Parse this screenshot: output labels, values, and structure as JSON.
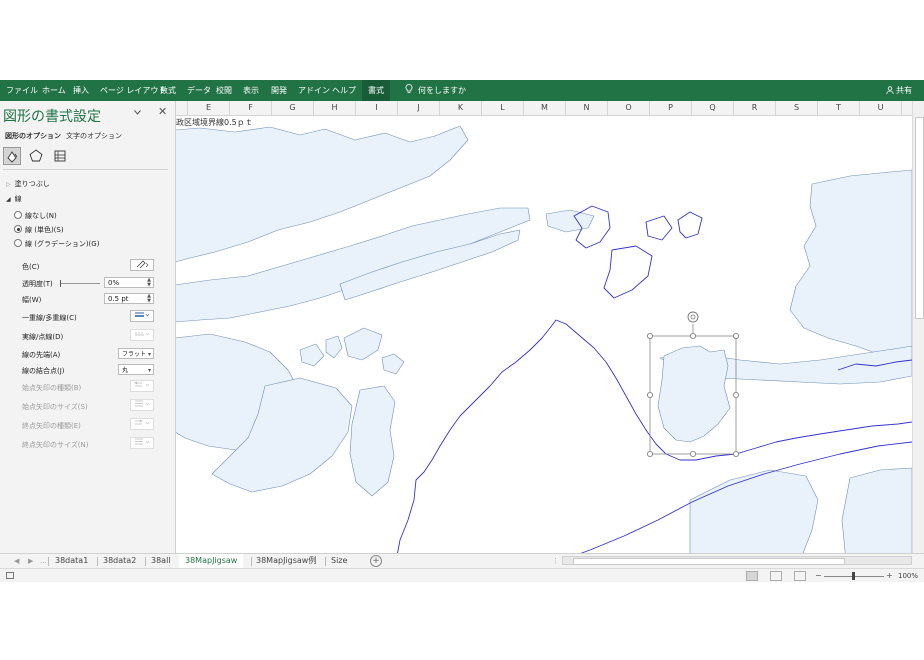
{
  "ribbon": {
    "tabs": [
      "ファイル",
      "ホーム",
      "挿入",
      "ページ レイアウト",
      "数式",
      "データ",
      "校閲",
      "表示",
      "開発",
      "アドイン",
      "ヘルプ"
    ],
    "active_tab": "書式",
    "tell_me": "何をしますか",
    "share": "共有",
    "bg_color": "#217346"
  },
  "columns": [
    "E",
    "F",
    "G",
    "H",
    "I",
    "J",
    "K",
    "L",
    "M",
    "N",
    "O",
    "P",
    "Q",
    "R",
    "S",
    "T",
    "U"
  ],
  "cell_text": "政区域境界線0.5ｐｔ",
  "pane": {
    "title": "図形の書式設定",
    "tabs": [
      "図形のオプション",
      "文字のオプション"
    ],
    "sections": {
      "fill": "塗りつぶし",
      "line": "線"
    },
    "line_options": [
      "線なし(N)",
      "線 (単色)(S)",
      "線 (グラデーション)(G)"
    ],
    "selected_line_option": 1,
    "props": {
      "color": "色(C)",
      "transparency": "透明度(T)",
      "transparency_value": "0%",
      "width": "幅(W)",
      "width_value": "0.5 pt",
      "compound": "一重線/多重線(C)",
      "dash": "実線/点線(D)",
      "cap": "線の先端(A)",
      "cap_value": "フラット",
      "join": "線の結合点(J)",
      "join_value": "丸",
      "begin_arrow_type": "始点矢印の種類(B)",
      "begin_arrow_size": "始点矢印のサイズ(S)",
      "end_arrow_type": "終点矢印の種類(E)",
      "end_arrow_size": "終点矢印のサイズ(N)"
    }
  },
  "sheets": [
    "38data1",
    "38data2",
    "38all",
    "38MapJigsaw",
    "38MapJigsaw例",
    "Size"
  ],
  "active_sheet": "38MapJigsaw",
  "zoom": "100%",
  "colors": {
    "land": "#e9f1fa",
    "land_stroke": "#5f7fa8",
    "boundary": "#3333cc",
    "accent": "#217346"
  }
}
